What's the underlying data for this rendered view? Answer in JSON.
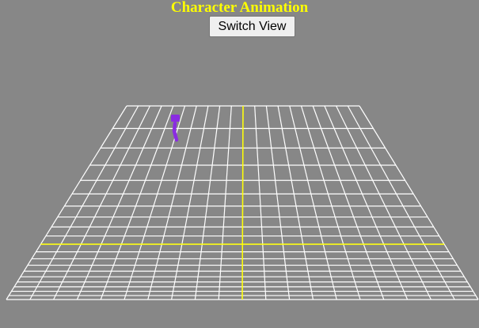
{
  "title": "Character Animation",
  "controls": {
    "switch_view_label": "Switch View"
  },
  "scene": {
    "background_color": "#878787",
    "grid_color": "#ffffff",
    "axis_color": "#ffff00",
    "character_color": "#8a2be2",
    "grid_divisions": 20
  }
}
